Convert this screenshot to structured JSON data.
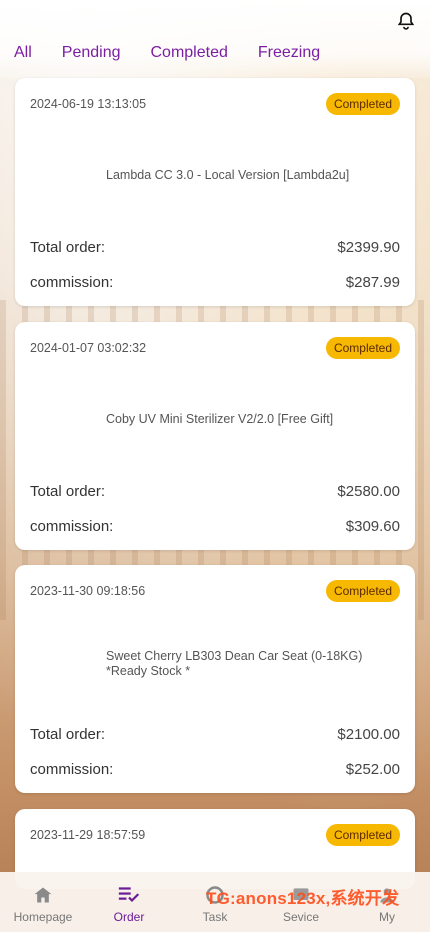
{
  "tabs": [
    "All",
    "Pending",
    "Completed",
    "Freezing"
  ],
  "orders": [
    {
      "date": "2024-06-19 13:13:05",
      "status": "Completed",
      "product": "Lambda CC 3.0 - Local Version [Lambda2u]",
      "total_label": "Total order:",
      "total": "$2399.90",
      "commission_label": "commission:",
      "commission": "$287.99"
    },
    {
      "date": "2024-01-07 03:02:32",
      "status": "Completed",
      "product": "Coby UV Mini Sterilizer V2/2.0 [Free Gift]",
      "total_label": "Total order:",
      "total": "$2580.00",
      "commission_label": "commission:",
      "commission": "$309.60"
    },
    {
      "date": "2023-11-30 09:18:56",
      "status": "Completed",
      "product": "Sweet Cherry LB303 Dean Car Seat (0-18KG) *Ready Stock *",
      "total_label": "Total order:",
      "total": "$2100.00",
      "commission_label": "commission:",
      "commission": "$252.00"
    },
    {
      "date": "2023-11-29 18:57:59",
      "status": "Completed"
    }
  ],
  "nav": [
    {
      "label": "Homepage",
      "icon": "home-icon"
    },
    {
      "label": "Order",
      "icon": "order-list-icon"
    },
    {
      "label": "Task",
      "icon": "task-icon"
    },
    {
      "label": "Sevice",
      "icon": "service-icon"
    },
    {
      "label": "My",
      "icon": "user-icon"
    }
  ],
  "watermark": "TG:anons123x,系统开发",
  "colors": {
    "accent": "#7b1fa2",
    "badge": "#f6b800",
    "watermark": "#ff4d1a"
  }
}
